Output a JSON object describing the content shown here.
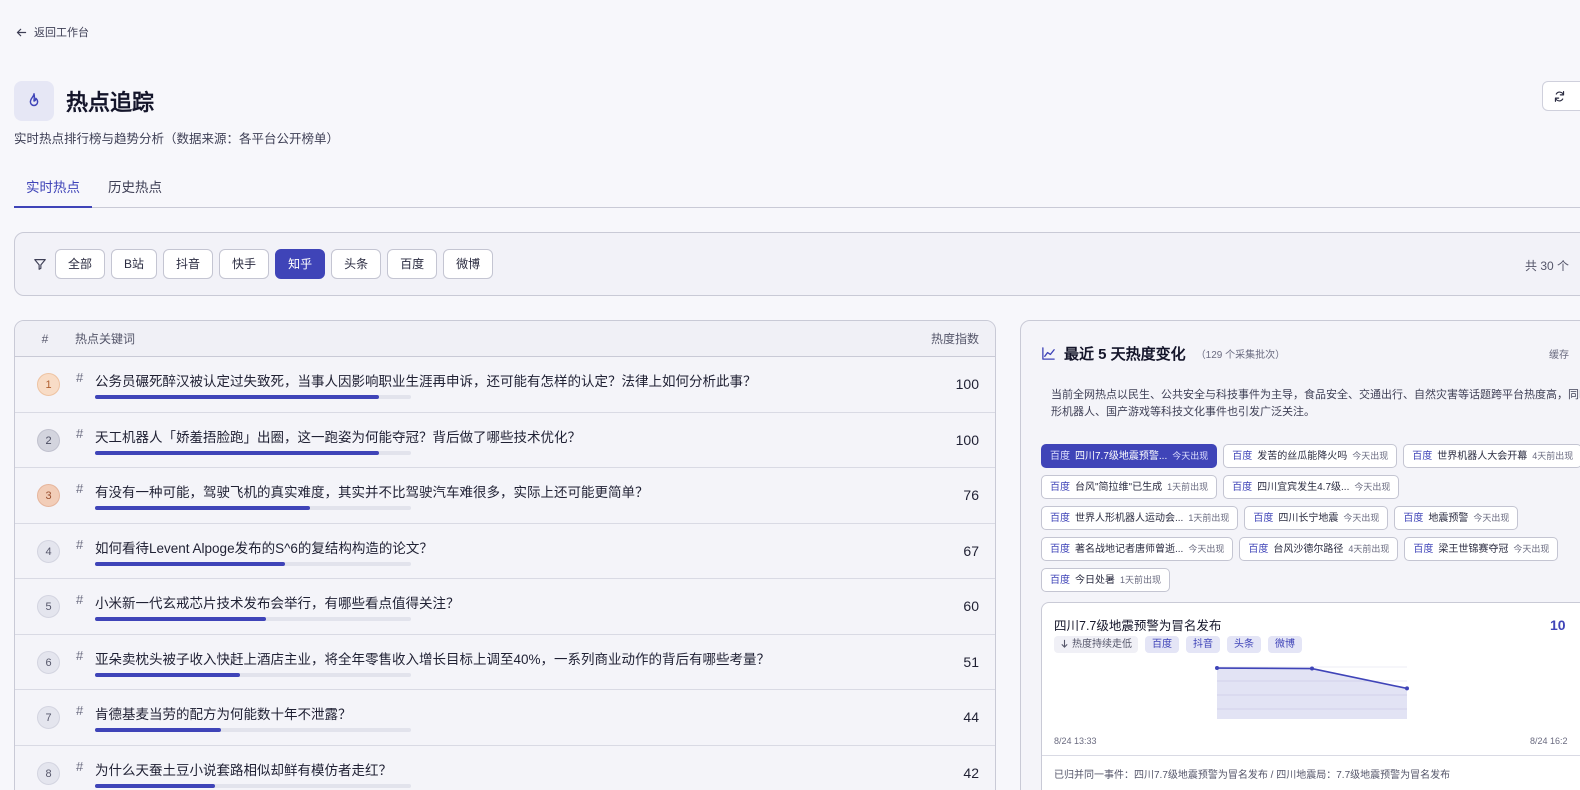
{
  "nav": {
    "back_label": "返回工作台"
  },
  "header": {
    "title": "热点追踪",
    "subtitle": "实时热点排行榜与趋势分析（数据来源：各平台公开榜单）",
    "refresh_icon": "refresh-icon"
  },
  "tabs": [
    {
      "label": "实时热点",
      "active": true
    },
    {
      "label": "历史热点",
      "active": false
    }
  ],
  "filters": {
    "chips": [
      "全部",
      "B站",
      "抖音",
      "快手",
      "知乎",
      "头条",
      "百度",
      "微博"
    ],
    "active": "知乎",
    "total_label": "共 30 个"
  },
  "list": {
    "col_rank": "#",
    "col_keyword": "热点关键词",
    "col_heat": "热度指数",
    "accent": "#3f44b8",
    "rows": [
      {
        "rank": "1",
        "keyword": "公务员碾死醉汉被认定过失致死，当事人因影响职业生涯再申诉，还可能有怎样的认定？法律上如何分析此事？",
        "heat": "100",
        "heat_fraction": 0.9
      },
      {
        "rank": "2",
        "keyword": "天工机器人「娇羞捂脸跑」出圈，这一跑姿为何能夺冠？背后做了哪些技术优化？",
        "heat": "100",
        "heat_fraction": 0.9
      },
      {
        "rank": "3",
        "keyword": "有没有一种可能，驾驶飞机的真实难度，其实并不比驾驶汽车难很多，实际上还可能更简单？",
        "heat": "76",
        "heat_fraction": 0.68
      },
      {
        "rank": "4",
        "keyword": "如何看待Levent Alpoge发布的S^6的复结构构造的论文？",
        "heat": "67",
        "heat_fraction": 0.6
      },
      {
        "rank": "5",
        "keyword": "小米新一代玄戒芯片技术发布会举行，有哪些看点值得关注？",
        "heat": "60",
        "heat_fraction": 0.54
      },
      {
        "rank": "6",
        "keyword": "亚朵卖枕头被子收入快赶上酒店主业，将全年零售收入增长目标上调至40%，一系列商业动作的背后有哪些考量？",
        "heat": "51",
        "heat_fraction": 0.46
      },
      {
        "rank": "7",
        "keyword": "肯德基麦当劳的配方为何能数十年不泄露？",
        "heat": "44",
        "heat_fraction": 0.4
      },
      {
        "rank": "8",
        "keyword": "为什么天蚕土豆小说套路相似却鲜有模仿者走红？",
        "heat": "42",
        "heat_fraction": 0.38
      }
    ]
  },
  "trend": {
    "title": "最近 5 天热度变化",
    "count": "（129 个采集批次）",
    "cache": "缓存",
    "summary": "当前全网热点以民生、公共安全与科技事件为主导，食品安全、交通出行、自然灾害等话题跨平台热度高，同时人形机器人、国产游戏等科技文化事件也引发广泛关注。",
    "tag_rows": [
      [
        {
          "src": "百度",
          "name": "四川7.7级地震预警...",
          "when": "今天出现",
          "active": true
        },
        {
          "src": "百度",
          "name": "发苦的丝瓜能降火吗",
          "when": "今天出现",
          "active": false
        },
        {
          "src": "百度",
          "name": "世界机器人大会开幕",
          "when": "4天前出现",
          "active": false
        }
      ],
      [
        {
          "src": "百度",
          "name": "台风\"简拉维\"已生成",
          "when": "1天前出现",
          "active": false
        },
        {
          "src": "百度",
          "name": "四川宜宾发生4.7级...",
          "when": "今天出现",
          "active": false
        }
      ],
      [
        {
          "src": "百度",
          "name": "世界人形机器人运动会...",
          "when": "1天前出现",
          "active": false
        },
        {
          "src": "百度",
          "name": "四川长宁地震",
          "when": "今天出现",
          "active": false
        },
        {
          "src": "百度",
          "name": "地震预警",
          "when": "今天出现",
          "active": false
        }
      ],
      [
        {
          "src": "百度",
          "name": "著名战地记者唐师曾逝...",
          "when": "今天出现",
          "active": false
        },
        {
          "src": "百度",
          "name": "台风沙德尔路径",
          "when": "4天前出现",
          "active": false
        },
        {
          "src": "百度",
          "name": "梁王世锦赛夺冠",
          "when": "今天出现",
          "active": false
        }
      ],
      [
        {
          "src": "百度",
          "name": "今日处暑",
          "when": "1天前出现",
          "active": false
        }
      ]
    ],
    "detail": {
      "title": "四川7.7级地震预警为冒名发布",
      "value": "10",
      "trend_label": "热度持续走低",
      "platforms": [
        "百度",
        "抖音",
        "头条",
        "微博"
      ],
      "x_start": "8/24 13:33",
      "x_end": "8/24 16:2",
      "merge_note": "已归并同一事件：四川7.7级地震预警为冒名发布 / 四川地震局：7.7级地震预警为冒名发布",
      "chart_data": {
        "type": "area",
        "x": [
          "8/24 13:33",
          "",
          "8/24 16:2"
        ],
        "series": [
          {
            "values": [
              100,
              99,
              60
            ]
          }
        ]
      }
    }
  }
}
